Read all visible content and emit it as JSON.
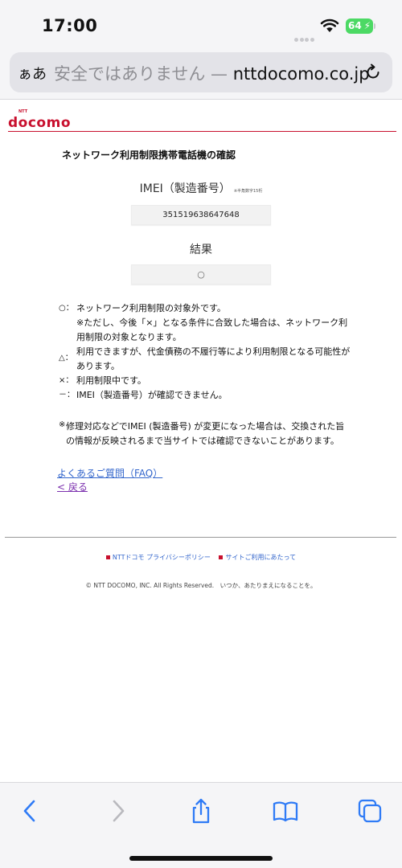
{
  "status_bar": {
    "time": "17:00",
    "battery": "64"
  },
  "address_bar": {
    "aa_label": "ぁあ",
    "security_text": "安全ではありません —",
    "domain": "nttdocomo.co.jp"
  },
  "header": {
    "logo_ntt": "NTT",
    "logo": "docomo"
  },
  "main": {
    "title": "ネットワーク利用制限携帯電話機の確認",
    "imei_label": "IMEI（製造番号）",
    "imei_note": "※半角数字15桁",
    "imei_value": "351519638647648",
    "result_label": "結果",
    "result_value": "○"
  },
  "legend": [
    {
      "symbol": "○：",
      "text": "ネットワーク利用制限の対象外です。"
    },
    {
      "symbol": "",
      "text": "※ただし、今後「×」となる条件に合致した場合は、ネットワーク利用制限の対象となります。"
    },
    {
      "symbol": "△：",
      "text": "利用できますが、代金債務の不履行等により利用制限となる可能性があります。"
    },
    {
      "symbol": "×：",
      "text": "利用制限中です。"
    },
    {
      "symbol": "－：",
      "text": "IMEI（製造番号）が確認できません。"
    }
  ],
  "notice": {
    "mark": "※",
    "text": "修理対応などでIMEI (製造番号) が変更になった場合は、交換された旨の情報が反映されるまで当サイトでは確認できないことがあります。"
  },
  "links": {
    "faq": "よくあるご質問（FAQ）",
    "back": "< 戻る"
  },
  "footer": {
    "privacy": "NTTドコモ プライバシーポリシー",
    "terms": "サイトご利用にあたって",
    "copyright": "© NTT DOCOMO, INC. All Rights Reserved.　いつか、あたりまえになることを。"
  },
  "colors": {
    "brand": "#c8102e",
    "link": "#3366cc",
    "visited_link": "#7b2fae",
    "battery": "#4cd964"
  },
  "icons": {
    "toolbar": [
      "back-icon",
      "forward-icon",
      "share-icon",
      "bookmarks-icon",
      "tabs-icon"
    ]
  }
}
